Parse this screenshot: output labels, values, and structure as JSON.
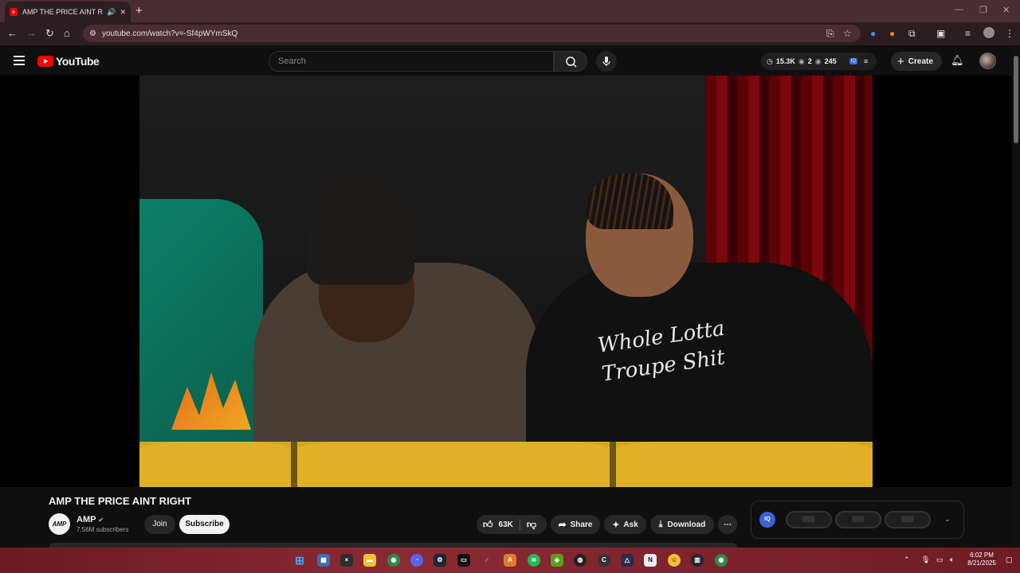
{
  "browser": {
    "tab_title": "AMP THE PRICE AINT RIGHT",
    "tab_audio_icon": "speaker-icon",
    "tab_close": "✕",
    "new_tab": "+",
    "url": "youtube.com/watch?v=-Sf4pWYmSkQ"
  },
  "youtube": {
    "logo_text": "YouTube",
    "search_placeholder": "Search",
    "stats": {
      "views": "15.3K",
      "viewers": "2",
      "watching": "245",
      "iq_label": "IQ"
    },
    "create_label": "Create"
  },
  "video": {
    "hoodie_line1": "Whole Lotta",
    "hoodie_line2": "Troupe Shit"
  },
  "details": {
    "title": "AMP THE PRICE AINT RIGHT",
    "channel_avatar_text": "AMP",
    "channel_name": "AMP",
    "subscribers": "7.56M subscribers",
    "join_label": "Join",
    "subscribe_label": "Subscribe",
    "likes": "63K",
    "share_label": "Share",
    "ask_label": "Ask",
    "download_label": "Download",
    "more_label": "⋯"
  },
  "iq_panel": {
    "badge": "IQ",
    "pills": [
      "▒▒▒",
      "▒▒▒",
      "▒▒▒"
    ]
  },
  "taskbar": {
    "time": "6:02 PM",
    "date": "8/21/2025"
  },
  "colors": {
    "youtube_red": "#ff0000",
    "taskbar": "#7a222b",
    "browser_frame": "#4a2c33"
  }
}
